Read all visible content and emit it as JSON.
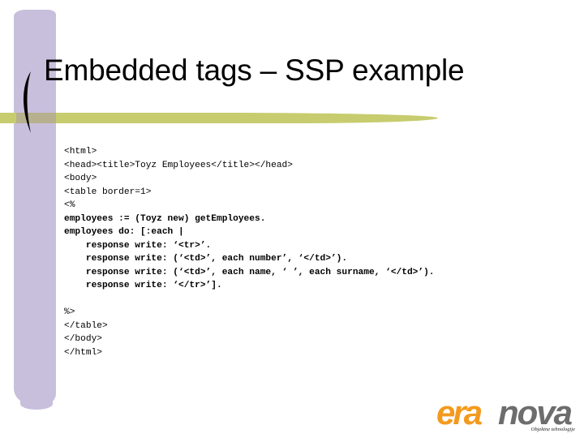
{
  "slide": {
    "title": "Embedded tags – SSP example",
    "code_lines": [
      {
        "text": "<html>",
        "bold": false
      },
      {
        "text": "<head><title>Toyz Employees</title></head>",
        "bold": false
      },
      {
        "text": "<body>",
        "bold": false
      },
      {
        "text": "<table border=1>",
        "bold": false
      },
      {
        "text": "<%",
        "bold": false
      },
      {
        "text": "employees := (Toyz new) getEmployees.",
        "bold": true
      },
      {
        "text": "employees do: [:each |",
        "bold": true
      },
      {
        "text": "    response write: ‘<tr>’.",
        "bold": true
      },
      {
        "text": "    response write: (‘<td>’, each number’, ‘</td>’).",
        "bold": true
      },
      {
        "text": "    response write: (‘<td>’, each name, ‘ ’, each surname, ‘</td>’).",
        "bold": true
      },
      {
        "text": "    response write: ‘</tr>’].",
        "bold": true
      },
      {
        "text": "",
        "bold": false
      },
      {
        "text": "%>",
        "bold": false
      },
      {
        "text": "</table>",
        "bold": false
      },
      {
        "text": "</body>",
        "bold": false
      },
      {
        "text": "</html>",
        "bold": false
      }
    ]
  },
  "logo": {
    "part1": "era",
    "part2": "nova",
    "tagline": "Objektne tehnologije",
    "colors": {
      "orange": "#f39a1e",
      "gray": "#6d6d6d"
    }
  },
  "theme": {
    "accent_purple": "#c8bfdc",
    "accent_green": "#c7cc6e"
  }
}
